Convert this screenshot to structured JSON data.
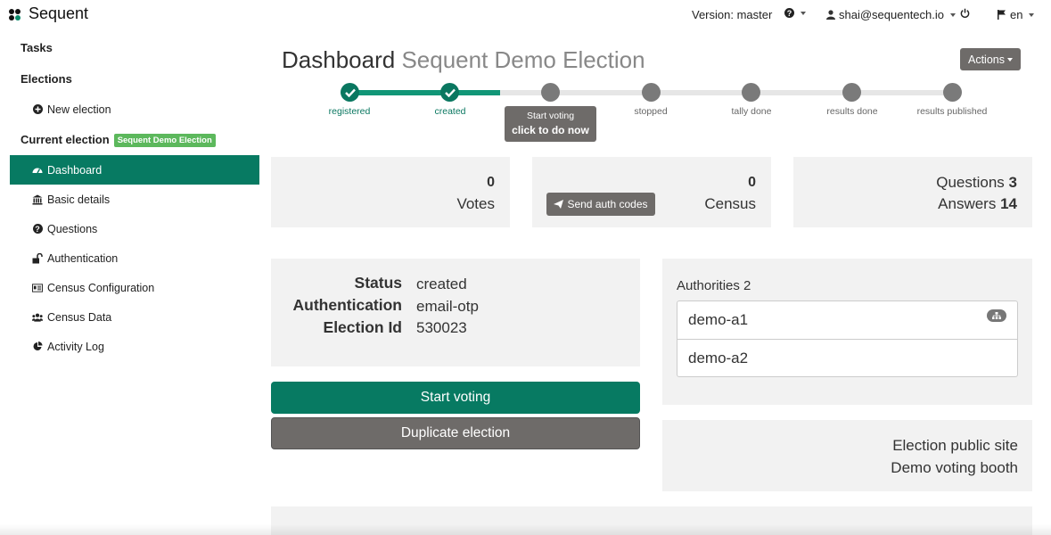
{
  "app": {
    "name": "Sequent"
  },
  "topbar": {
    "version": "Version: master",
    "user": "shai@sequentech.io",
    "language": "en"
  },
  "sidebar": {
    "tasks": "Tasks",
    "elections": "Elections",
    "new_election": "New election",
    "current_election_label": "Current election",
    "current_election_badge": "Sequent Demo Election",
    "items": [
      {
        "label": "Dashboard",
        "icon": "dashboard-icon",
        "active": true
      },
      {
        "label": "Basic details",
        "icon": "bank-icon"
      },
      {
        "label": "Questions",
        "icon": "question-circle-icon"
      },
      {
        "label": "Authentication",
        "icon": "unlock-icon"
      },
      {
        "label": "Census Configuration",
        "icon": "id-card-icon"
      },
      {
        "label": "Census Data",
        "icon": "users-icon"
      },
      {
        "label": "Activity Log",
        "icon": "pie-chart-icon"
      }
    ]
  },
  "page": {
    "title": "Dashboard",
    "subtitle": "Sequent Demo Election",
    "actions": "Actions"
  },
  "progress": {
    "steps": [
      {
        "label": "registered",
        "done": true
      },
      {
        "label": "created",
        "done": true
      },
      {
        "label": "",
        "done": false
      },
      {
        "label": "stopped",
        "done": false
      },
      {
        "label": "tally done",
        "done": false
      },
      {
        "label": "results done",
        "done": false
      },
      {
        "label": "results published",
        "done": false
      }
    ],
    "tooltip_line1": "Start voting",
    "tooltip_line2": "click to do now"
  },
  "stats": {
    "votes_count": "0",
    "votes_label": "Votes",
    "census_count": "0",
    "census_label": "Census",
    "send_auth_codes": "Send auth codes",
    "questions_label": "Questions",
    "questions_count": "3",
    "answers_label": "Answers",
    "answers_count": "14"
  },
  "details": {
    "status_label": "Status",
    "status_value": "created",
    "auth_label": "Authentication",
    "auth_value": "email-otp",
    "id_label": "Election Id",
    "id_value": "530023"
  },
  "authorities": {
    "title": "Authorities",
    "count": "2",
    "items": [
      "demo-a1",
      "demo-a2"
    ]
  },
  "buttons": {
    "start_voting": "Start voting",
    "duplicate": "Duplicate election"
  },
  "public": {
    "site": "Election public site",
    "booth": "Demo voting booth"
  },
  "colors": {
    "brand": "#077a62",
    "grey_button": "#6e6b69",
    "badge": "#5cb85c"
  }
}
